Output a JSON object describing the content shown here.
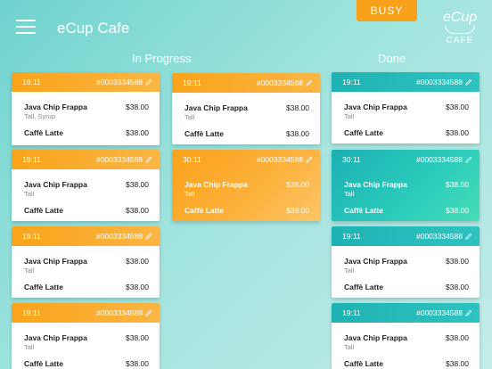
{
  "header": {
    "title": "eCup Cafe",
    "busy_label": "BUSY",
    "logo": {
      "main": "eCup",
      "sub": "CAFE"
    }
  },
  "columns": {
    "in_progress": "In Progress",
    "done": "Done"
  },
  "colors": {
    "accent_orange": "#f9a31a",
    "accent_teal": "#1fb2b4"
  },
  "cards": [
    {
      "time": "19:11",
      "order": "#0003334588",
      "item1": "Java Chip Frappa",
      "item1_opt": "Tall, Syrup",
      "item1_price": "$38.00",
      "item2": "Caffè Latte",
      "item2_price": "$38.00"
    },
    {
      "time": "19:11",
      "order": "#0003334588",
      "item1": "Java Chip Frappa",
      "item1_opt": "Tall",
      "item1_price": "$38.00",
      "item2": "Caffè Latte",
      "item2_price": "$38.00"
    },
    {
      "time": "19:11",
      "order": "#0003334588",
      "item1": "Java Chip Frappa",
      "item1_opt": "Tall",
      "item1_price": "$38.00",
      "item2": "Caffè Latte",
      "item2_price": "$38.00"
    },
    {
      "time": "19:11",
      "order": "#0003334588",
      "item1": "Java Chip Frappa",
      "item1_opt": "Tall",
      "item1_price": "$38.00",
      "item2": "Caffè Latte",
      "item2_price": "$38.00"
    },
    {
      "time": "19:11",
      "order": "#0003334588",
      "item1": "Java Chip Frappa",
      "item1_opt": "Tall",
      "item1_price": "$38.00",
      "item2": "Caffè Latte",
      "item2_price": "$38.00"
    },
    {
      "time": "30:11",
      "order": "#0003334588",
      "item1": "Java Chip Frappa",
      "item1_opt": "Tall",
      "item1_price": "$38.00",
      "item2": "Caffè Latte",
      "item2_price": "$38.00"
    },
    {
      "time": "19:11",
      "order": "#0003334588",
      "item1": "Java Chip Frappa",
      "item1_opt": "Tall",
      "item1_price": "$38.00",
      "item2": "Caffè Latte",
      "item2_price": "$38.00"
    },
    {
      "time": "30:11",
      "order": "#0003334588",
      "item1": "Java Chip Frappa",
      "item1_opt": "Tall",
      "item1_price": "$38.00",
      "item2": "Caffè Latte",
      "item2_price": "$38.00"
    },
    {
      "time": "19:11",
      "order": "#0003334588",
      "item1": "Java Chip Frappa",
      "item1_opt": "Tall",
      "item1_price": "$38.00",
      "item2": "Caffè Latte",
      "item2_price": "$38.00"
    },
    {
      "time": "19:11",
      "order": "#0003334588",
      "item1": "Java Chip Frappa",
      "item1_opt": "Tall",
      "item1_price": "$38.00",
      "item2": "Caffè Latte",
      "item2_price": "$38.00"
    }
  ]
}
